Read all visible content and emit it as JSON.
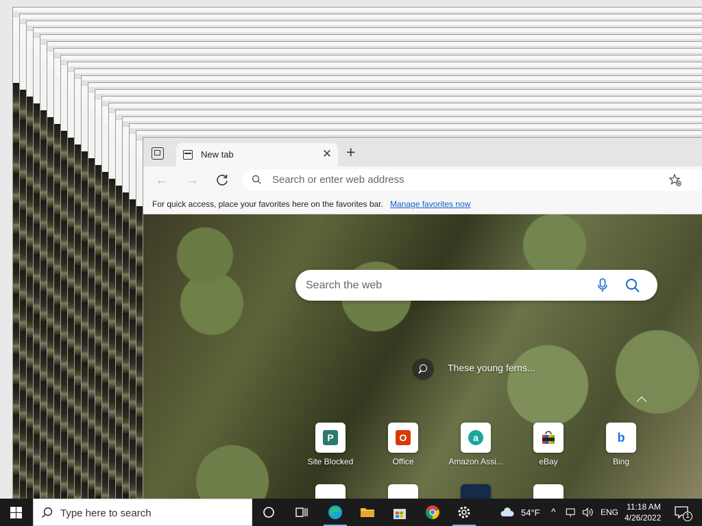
{
  "browser": {
    "tab_title": "New tab",
    "address_placeholder": "Search or enter web address",
    "favorites_message": "For quick access, place your favorites here on the favorites bar.",
    "favorites_link": "Manage favorites now"
  },
  "newtab": {
    "search_placeholder": "Search the web",
    "image_caption": "These young ferns...",
    "tiles": [
      {
        "label": "Site Blocked",
        "letter": "P",
        "color": "#2a7b6b"
      },
      {
        "label": "Office",
        "letter": "O",
        "color": "#d83b01"
      },
      {
        "label": "Amazon Assi...",
        "letter": "a",
        "color": "#1aa89a"
      },
      {
        "label": "eBay",
        "letter": "",
        "color": "#e53238"
      },
      {
        "label": "Bing",
        "letter": "b",
        "color": "#1a73e8"
      }
    ]
  },
  "taskbar": {
    "search_placeholder": "Type here to search",
    "weather": "54°F",
    "language": "ENG",
    "time": "11:18 AM",
    "date": "4/26/2022",
    "notification_count": "1"
  },
  "colors": {
    "accent": "#0b63c5",
    "taskbar": "#1b1b1b"
  }
}
